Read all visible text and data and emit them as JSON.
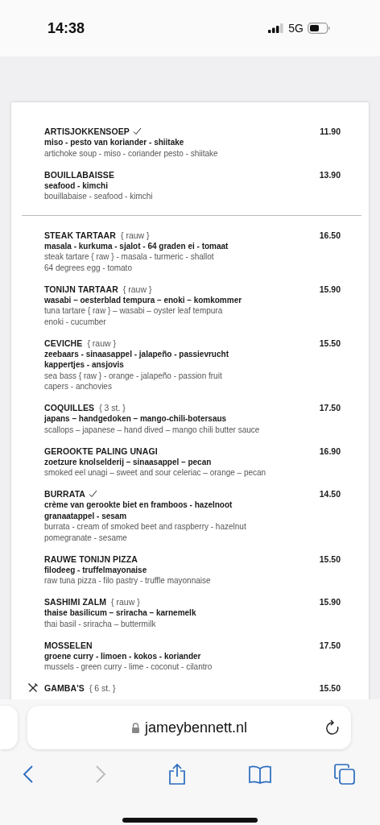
{
  "status_bar": {
    "time": "14:38",
    "network": "5G"
  },
  "sections": [
    {
      "items": [
        {
          "name": "ARTISJOKKENSOEP",
          "checked": true,
          "price": "11.90",
          "nl": [
            "miso - pesto van koriander -  shiitake"
          ],
          "en": [
            "artichoke soup - miso - coriander pesto - shiitake"
          ]
        },
        {
          "name": "BOUILLABAISSE",
          "checked": false,
          "price": "13.90",
          "nl": [
            "seafood - kimchi"
          ],
          "en": [
            "bouillabaise - seafood - kimchi"
          ]
        }
      ]
    },
    {
      "items": [
        {
          "name": "STEAK TARTAAR",
          "note": "{ rauw }",
          "checked": false,
          "price": "16.50",
          "nl": [
            "masala - kurkuma - sjalot - 64 graden ei - tomaat"
          ],
          "en": [
            "steak tartare { raw } - masala - turmeric - shallot",
            "64 degrees egg - tomato"
          ]
        },
        {
          "name": "TONIJN TARTAAR",
          "note": "{ rauw }",
          "checked": false,
          "price": "15.90",
          "nl": [
            "wasabi – oesterblad tempura – enoki – komkommer"
          ],
          "en": [
            "tuna tartare { raw } – wasabi – oyster leaf tempura",
            "enoki - cucumber"
          ]
        },
        {
          "name": "CEVICHE",
          "note": "{ rauw }",
          "checked": false,
          "price": "15.50",
          "nl": [
            "zeebaars - sinaasappel - jalapeño - passievrucht",
            "kappertjes - ansjovis"
          ],
          "en": [
            "sea bass { raw } - orange - jalapeño - passion fruit",
            "capers - anchovies"
          ]
        },
        {
          "name": "COQUILLES",
          "note": "{ 3 st. }",
          "checked": false,
          "price": "17.50",
          "nl": [
            "japans – handgedoken – mango-chili-botersaus"
          ],
          "en": [
            "scallops – japanese – hand dived – mango chili butter sauce"
          ]
        },
        {
          "name": "GEROOKTE PALING UNAGI",
          "checked": false,
          "price": "16.90",
          "nl": [
            "zoetzure knolselderij – sinaasappel – pecan"
          ],
          "en": [
            "smoked eel unagi – sweet and sour celeriac – orange – pecan"
          ]
        },
        {
          "name": "BURRATA",
          "checked": true,
          "price": "14.50",
          "nl": [
            "crème van gerookte biet en framboos - hazelnoot",
            "granaatappel - sesam"
          ],
          "en": [
            "burrata - cream of smoked beet and raspberry - hazelnut",
            "pomegranate - sesame"
          ]
        },
        {
          "name": "RAUWE TONIJN PIZZA",
          "checked": false,
          "price": "15.50",
          "nl": [
            "filodeeg - truffelmayonaise"
          ],
          "en": [
            "raw tuna pizza - filo pastry - truffle mayonnaise"
          ]
        },
        {
          "name": "SASHIMI ZALM",
          "note": "{ rauw }",
          "checked": false,
          "price": "15.90",
          "nl": [
            "thaise basilicum – sriracha – karnemelk"
          ],
          "en": [
            "thai basil - sriracha – buttermilk"
          ]
        },
        {
          "name": "MOSSELEN",
          "checked": false,
          "price": "17.50",
          "nl": [
            "groene curry - limoen - kokos - koriander"
          ],
          "en": [
            "mussels - green curry - lime - coconut - cilantro"
          ]
        },
        {
          "name": "GAMBA'S",
          "note": "{ 6 st. }",
          "checked": false,
          "marker": true,
          "price": "15.50"
        }
      ]
    }
  ],
  "address_bar": {
    "domain": "jameybennett.nl"
  }
}
